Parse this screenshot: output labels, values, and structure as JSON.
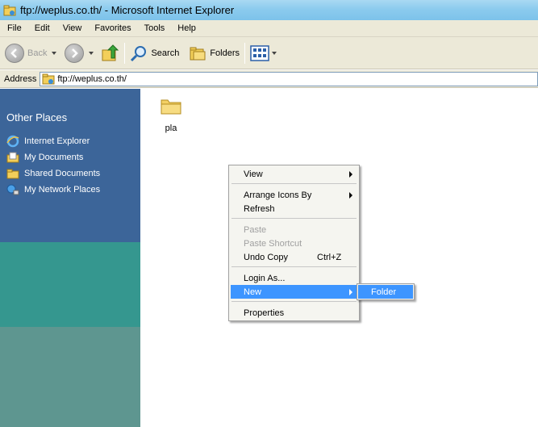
{
  "window": {
    "title": "ftp://weplus.co.th/ - Microsoft Internet Explorer"
  },
  "menu": [
    "File",
    "Edit",
    "View",
    "Favorites",
    "Tools",
    "Help"
  ],
  "toolbar": {
    "back": "Back",
    "search": "Search",
    "folders": "Folders"
  },
  "address": {
    "label": "Address",
    "value": "ftp://weplus.co.th/"
  },
  "sidebar": {
    "heading": "Other Places",
    "items": [
      {
        "label": "Internet Explorer",
        "icon": "ie-icon"
      },
      {
        "label": "My Documents",
        "icon": "documents-folder-icon"
      },
      {
        "label": "Shared Documents",
        "icon": "folder-icon"
      },
      {
        "label": "My Network Places",
        "icon": "network-icon"
      }
    ]
  },
  "files": [
    {
      "name": "pla",
      "icon": "folder-icon"
    }
  ],
  "context_menu": {
    "view": "View",
    "arrange": "Arrange Icons By",
    "refresh": "Refresh",
    "paste": "Paste",
    "paste_shortcut": "Paste Shortcut",
    "undo_copy": "Undo Copy",
    "undo_shortcut": "Ctrl+Z",
    "login_as": "Login As...",
    "new": "New",
    "properties": "Properties"
  },
  "submenu": {
    "folder": "Folder"
  },
  "colors": {
    "selection": "#3d95ff",
    "sidebar_blue": "#3c6599",
    "sidebar_teal": "#35978f"
  }
}
